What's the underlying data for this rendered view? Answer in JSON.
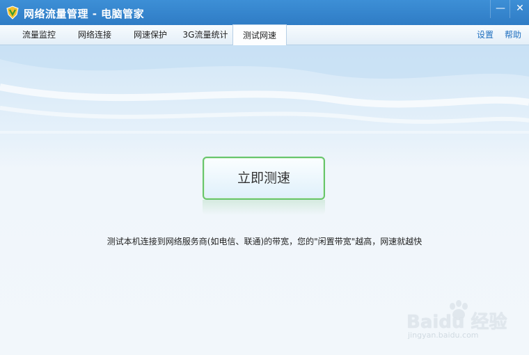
{
  "window": {
    "title": "网络流量管理 - 电脑管家",
    "minimize_glyph": "—",
    "close_glyph": "✕"
  },
  "tabs": [
    {
      "label": "流量监控"
    },
    {
      "label": "网络连接"
    },
    {
      "label": "网速保护"
    },
    {
      "label": "3G流量统计"
    },
    {
      "label": "测试网速",
      "active": true
    }
  ],
  "tab_links": {
    "settings": "设置",
    "help": "帮助"
  },
  "main": {
    "test_button_label": "立即测速",
    "description": "测试本机连接到网络服务商(如电信、联通)的带宽，您的\"闲置带宽\"越高，网速就越快"
  },
  "watermark": {
    "logo": "Baidu 经验",
    "url": "jingyan.baidu.com"
  },
  "colors": {
    "titlebar": "#2f7cc5",
    "button_border": "#67c56a",
    "link": "#1f6fbf"
  },
  "icons": {
    "app": "shield-v-logo-icon",
    "minimize": "minimize-icon",
    "close": "close-icon"
  }
}
